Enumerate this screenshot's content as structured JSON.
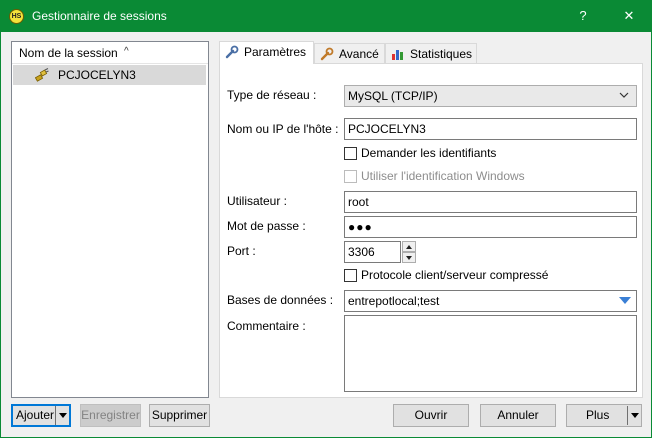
{
  "window": {
    "title": "Gestionnaire de sessions",
    "app_icon_text": "HS",
    "help_glyph": "?",
    "close_glyph": "✕"
  },
  "session_tree": {
    "column_header": "Nom de la session",
    "sort_glyph": "^",
    "sessions": [
      {
        "name": "PCJOCELYN3",
        "selected": true,
        "icon": "session-plug-icon"
      }
    ]
  },
  "tabs": [
    {
      "label": "Paramètres",
      "icon": "wrench-icon",
      "active": true
    },
    {
      "label": "Avancé",
      "icon": "wrench-icon",
      "active": false
    },
    {
      "label": "Statistiques",
      "icon": "bar-chart-icon",
      "active": false
    }
  ],
  "form": {
    "network_type_label": "Type de réseau :",
    "network_type_value": "MySQL (TCP/IP)",
    "host_label": "Nom ou IP de l'hôte :",
    "host_value": "PCJOCELYN3",
    "prompt_credentials_label": "Demander les identifiants",
    "prompt_credentials_checked": false,
    "windows_auth_label": "Utiliser l'identification Windows",
    "windows_auth_checked": false,
    "windows_auth_enabled": false,
    "user_label": "Utilisateur :",
    "user_value": "root",
    "password_label": "Mot de passe :",
    "password_value": "●●●",
    "port_label": "Port :",
    "port_value": "3306",
    "compressed_label": "Protocole client/serveur compressé",
    "compressed_checked": false,
    "databases_label": "Bases de données :",
    "databases_value": "entrepotlocal;test",
    "comment_label": "Commentaire :",
    "comment_value": ""
  },
  "buttons": {
    "add": "Ajouter",
    "save": "Enregistrer",
    "delete": "Supprimer",
    "open": "Ouvrir",
    "cancel": "Annuler",
    "more": "Plus"
  },
  "colors": {
    "titlebar": "#0a8a35",
    "selection": "#d9d9d9",
    "focus": "#0078d7",
    "combo_arrow": "#3a7fd5"
  }
}
